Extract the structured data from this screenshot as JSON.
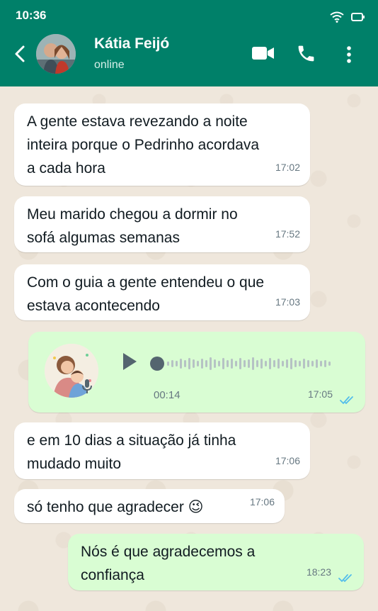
{
  "status_bar": {
    "time": "10:36",
    "icons": [
      "wifi-icon",
      "battery-icon"
    ]
  },
  "header": {
    "contact_name": "Kátia Feijó",
    "contact_status": "online",
    "icons": [
      "back-icon",
      "video-call-icon",
      "phone-icon",
      "more-icon"
    ]
  },
  "colors": {
    "header": "#008069",
    "incoming": "#ffffff",
    "outgoing": "#d9fdd3",
    "read_ticks": "#53bdeb"
  },
  "messages": [
    {
      "direction": "in",
      "text": [
        "A gente estava revezando a noite",
        "inteira porque o Pedrinho acordava",
        "a cada hora"
      ],
      "time": "17:02"
    },
    {
      "direction": "in",
      "text": [
        "Meu marido chegou a dormir no",
        "sofá algumas semanas"
      ],
      "time": "17:52"
    },
    {
      "direction": "in",
      "text": [
        "Com o guia a gente entendeu o que",
        "estava acontecendo"
      ],
      "time": "17:03"
    },
    {
      "direction": "out",
      "type": "voice",
      "duration": "00:14",
      "time": "17:05"
    },
    {
      "direction": "in",
      "text": [
        "e em 10 dias a situação já tinha",
        "mudado muito"
      ],
      "time": "17:06"
    },
    {
      "direction": "in",
      "text": [
        "só tenho que agradecer 😉"
      ],
      "time": "17:06"
    },
    {
      "direction": "out",
      "text": [
        "Nós é que agradecemos a",
        "confiança"
      ],
      "time": "18:23"
    }
  ]
}
